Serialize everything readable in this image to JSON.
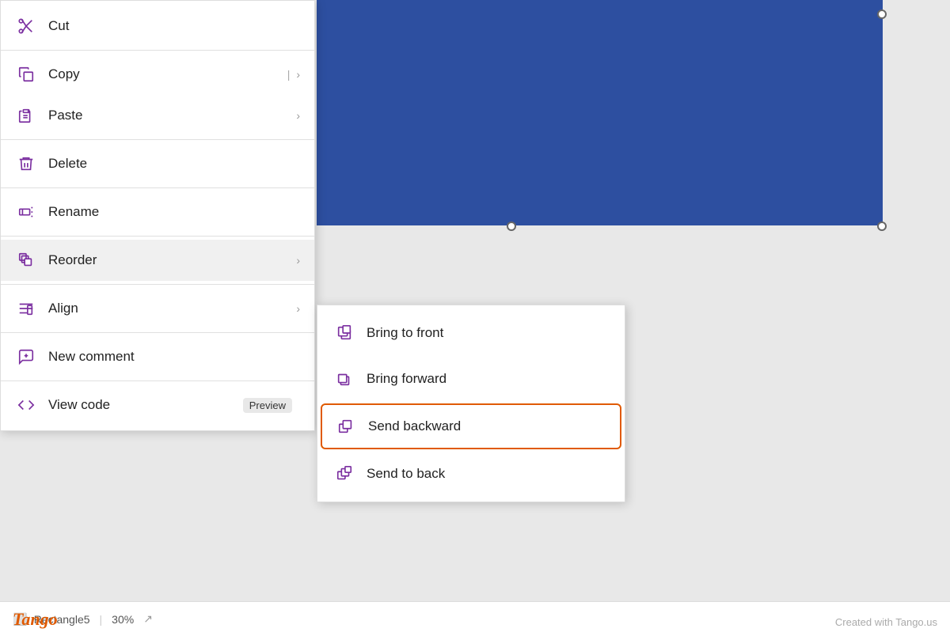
{
  "canvas": {
    "background": "#e8e8e8",
    "blue_rect": {
      "color": "#2d4fa0"
    }
  },
  "context_menu": {
    "items": [
      {
        "id": "cut",
        "label": "Cut",
        "icon": "scissors-icon",
        "shortcut": "",
        "arrow": false,
        "divider_after": false
      },
      {
        "id": "copy",
        "label": "Copy",
        "icon": "copy-icon",
        "shortcut": "|",
        "arrow": true,
        "divider_after": false
      },
      {
        "id": "paste",
        "label": "Paste",
        "icon": "paste-icon",
        "shortcut": "",
        "arrow": true,
        "divider_after": false
      },
      {
        "id": "delete",
        "label": "Delete",
        "icon": "delete-icon",
        "shortcut": "",
        "arrow": false,
        "divider_after": false
      },
      {
        "id": "rename",
        "label": "Rename",
        "icon": "rename-icon",
        "shortcut": "",
        "arrow": false,
        "divider_after": false
      },
      {
        "id": "reorder",
        "label": "Reorder",
        "icon": "reorder-icon",
        "shortcut": "",
        "arrow": true,
        "divider_after": false,
        "active": true
      },
      {
        "id": "align",
        "label": "Align",
        "icon": "align-icon",
        "shortcut": "",
        "arrow": true,
        "divider_after": false
      },
      {
        "id": "new-comment",
        "label": "New comment",
        "icon": "comment-icon",
        "shortcut": "",
        "arrow": false,
        "divider_after": false
      },
      {
        "id": "view-code",
        "label": "View code",
        "icon": "code-icon",
        "shortcut": "",
        "badge": "Preview",
        "arrow": false,
        "divider_after": false
      }
    ]
  },
  "submenu": {
    "items": [
      {
        "id": "bring-to-front",
        "label": "Bring to front",
        "icon": "bring-front-icon"
      },
      {
        "id": "bring-forward",
        "label": "Bring forward",
        "icon": "bring-forward-icon"
      },
      {
        "id": "send-backward",
        "label": "Send backward",
        "icon": "send-backward-icon",
        "highlighted": true
      },
      {
        "id": "send-to-back",
        "label": "Send to back",
        "icon": "send-back-icon"
      }
    ]
  },
  "bottom_bar": {
    "shape_label": "Rectangle5",
    "zoom": "30%"
  },
  "branding": {
    "logo": "Tango",
    "watermark": "Created with Tango.us"
  }
}
